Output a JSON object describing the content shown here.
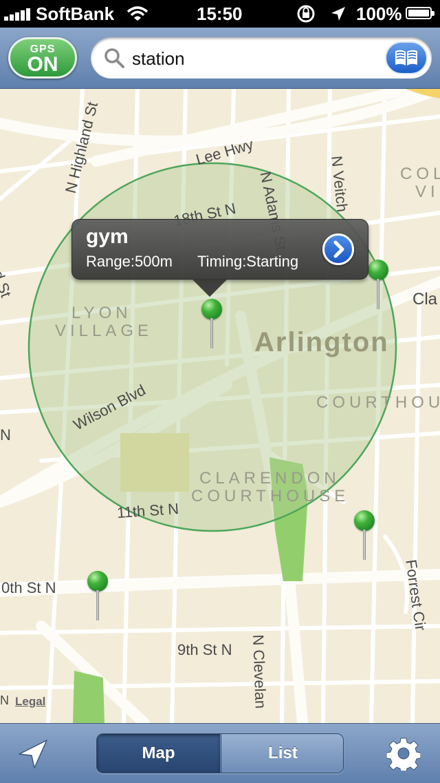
{
  "status_bar": {
    "carrier": "SoftBank",
    "time": "15:50",
    "battery_percent": "100%",
    "battery_level": 1.0,
    "icons": [
      "signal-icon",
      "wifi-icon",
      "rotation-lock-icon",
      "location-arrow-icon",
      "battery-icon"
    ]
  },
  "top_bar": {
    "gps_label": "GPS",
    "gps_state": "ON",
    "search_value": "station",
    "search_icon": "search-icon",
    "bookmarks_icon": "book-icon"
  },
  "map": {
    "street_labels": {
      "lee_hwy": "Lee Hwy",
      "n_harvard": "N Harvard St",
      "n_highland": "N Highland St",
      "st_18th": "18th St N",
      "n_adams": "N Adams St",
      "n_veitch": "N Veitch",
      "clar": "Cla",
      "wilson": "Wilson Blvd",
      "st_11th": "11th St N",
      "st_10th": "0th St N",
      "st_9th": "9th St N",
      "n_cleveland": "N Clevelan",
      "forrest": "Forrest Cir",
      "n_left": "N",
      "n_bottom": "N"
    },
    "district_labels": {
      "lyon_line1": "LYON",
      "lyon_line2": "VILLAGE",
      "arlington": "Arlington",
      "courthouse": "COURTHOU",
      "clarendon_line1": "CLARENDON",
      "clarendon_line2": "COURTHOUSE",
      "colvi_line1": "COL",
      "colvi_line2": "VI"
    },
    "legal": "Legal",
    "pins": [
      "gym",
      "pin-east",
      "pin-southeast",
      "pin-southwest"
    ]
  },
  "callout": {
    "title": "gym",
    "range": "Range:500m",
    "timing": "Timing:Starting",
    "disclosure_icon": "chevron-right-icon"
  },
  "bottom_bar": {
    "locate_icon": "location-arrow-icon",
    "segments": [
      "Map",
      "List"
    ],
    "selected_segment": "Map",
    "settings_icon": "gear-icon"
  },
  "colors": {
    "gps_on": "#3fae45",
    "toolbar": "#6f8db6",
    "radius_fill": "#c9d8a8",
    "radius_stroke": "#4da65a",
    "pin": "#2fa032",
    "accent_blue": "#1b5fc8"
  }
}
